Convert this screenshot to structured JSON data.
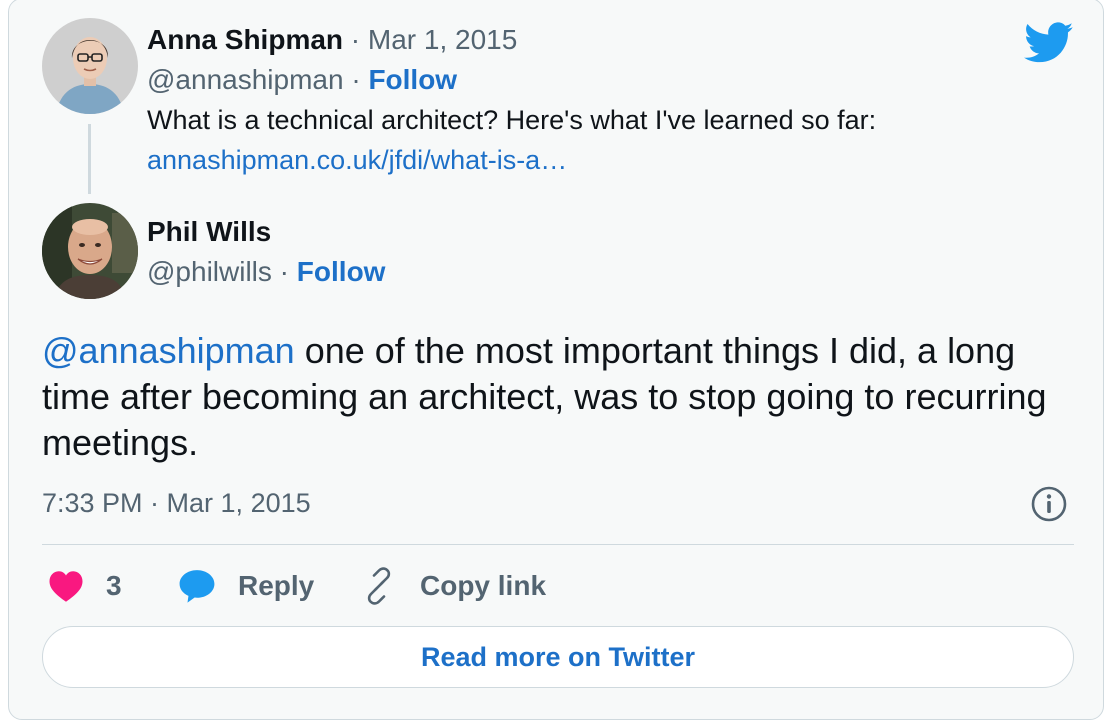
{
  "quoted_tweet": {
    "author_name": "Anna Shipman",
    "date_sep": " · ",
    "date": "Mar 1, 2015",
    "handle": "@annashipman",
    "handle_sep": " · ",
    "follow_label": "Follow",
    "text": "What is a technical architect? Here's what I've learned so far:",
    "link": "annashipman.co.uk/jfdi/what-is-a…"
  },
  "tweet": {
    "author_name": "Phil Wills",
    "handle": "@philwills",
    "handle_sep": " · ",
    "follow_label": "Follow",
    "mention": "@annashipman",
    "text": " one of the most important things I did, a long time after becoming an architect, was to stop going to recurring meetings.",
    "timestamp": "7:33 PM · Mar 1, 2015"
  },
  "actions": {
    "like_count": "3",
    "reply_label": "Reply",
    "copy_link_label": "Copy link"
  },
  "read_more_label": "Read more on Twitter",
  "colors": {
    "link_blue": "#1d70c8",
    "twitter_blue": "#1d9bf0",
    "heart": "#f91880",
    "text": "#0f1419",
    "muted": "#536471"
  }
}
